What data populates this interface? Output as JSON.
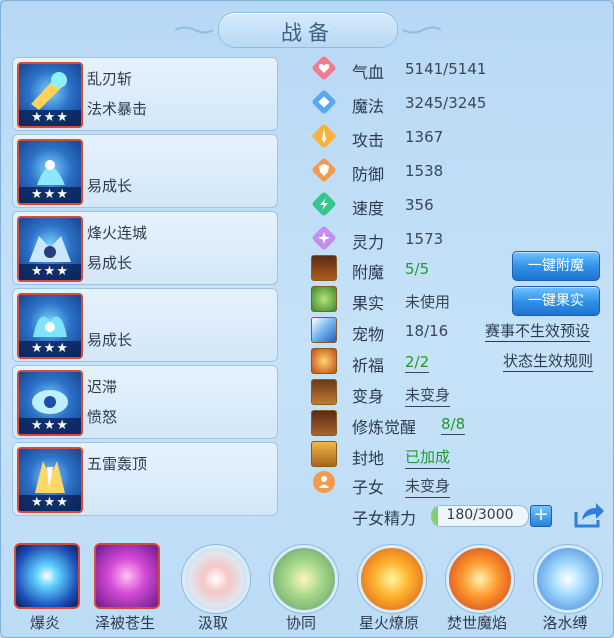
{
  "title": "战备",
  "skills": [
    {
      "name": "乱刃斩",
      "sub": "法术暴击",
      "stars": "★★★"
    },
    {
      "name": "",
      "sub": "易成长",
      "stars": "★★★"
    },
    {
      "name": "烽火连城",
      "sub": "易成长",
      "stars": "★★★"
    },
    {
      "name": "",
      "sub": "易成长",
      "stars": "★★★"
    },
    {
      "name": "迟滞",
      "sub": "愤怒",
      "stars": "★★★"
    },
    {
      "name": "五雷轰顶",
      "sub": "",
      "stars": "★★★"
    }
  ],
  "stats": [
    {
      "label": "气血",
      "value": "5141/5141",
      "icon": "heart-icon",
      "color": "#f27a8a"
    },
    {
      "label": "魔法",
      "value": "3245/3245",
      "icon": "mana-icon",
      "color": "#5aa8f2"
    },
    {
      "label": "攻击",
      "value": "1367",
      "icon": "attack-icon",
      "color": "#f6b23a"
    },
    {
      "label": "防御",
      "value": "1538",
      "icon": "defense-icon",
      "color": "#f49a4c"
    },
    {
      "label": "速度",
      "value": "356",
      "icon": "speed-icon",
      "color": "#33c78e"
    },
    {
      "label": "灵力",
      "value": "1573",
      "icon": "spirit-icon",
      "color": "#c28ef0"
    }
  ],
  "equip": [
    {
      "label": "附魔",
      "value": "5/5",
      "icon": "enchant-icon"
    },
    {
      "label": "果实",
      "value": "未使用",
      "icon": "fruit-icon"
    },
    {
      "label": "宠物",
      "value": "18/16",
      "icon": "pet-icon"
    },
    {
      "label": "祈福",
      "value": "2/2",
      "icon": "blessing-icon"
    },
    {
      "label": "变身",
      "value": "未变身",
      "icon": "transform-icon"
    },
    {
      "label": "修炼觉醒",
      "value": "8/8",
      "icon": "cultivation-icon"
    },
    {
      "label": "封地",
      "value": "已加成",
      "icon": "fief-icon"
    },
    {
      "label": "子女",
      "value": "未变身",
      "icon": "child-icon"
    }
  ],
  "buttons": {
    "enchant": "一键附魔",
    "fruit": "一键果实"
  },
  "links": {
    "preset": "赛事不生效预设",
    "rules": "状态生效规则"
  },
  "child_energy": {
    "label": "子女精力",
    "value": "180/3000",
    "fraction": 0.06
  },
  "bottom_skills": [
    "爆炎",
    "泽被苍生",
    "汲取",
    "协同",
    "星火燎原",
    "焚世魔焰",
    "洛水缚"
  ]
}
